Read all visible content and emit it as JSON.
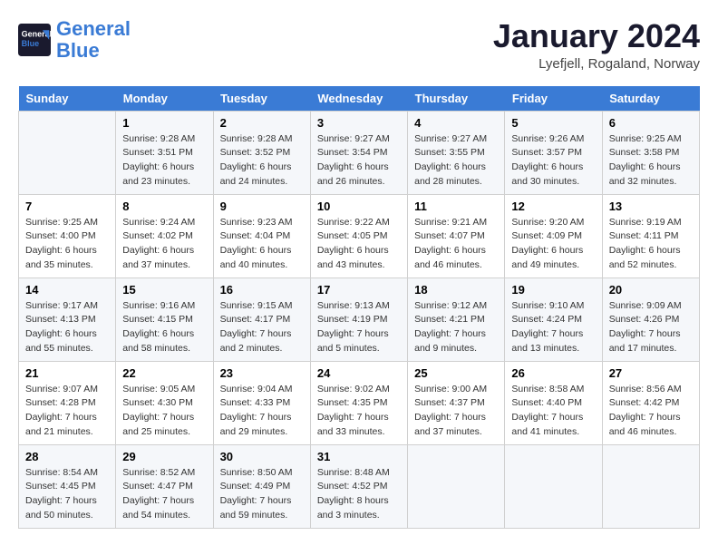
{
  "header": {
    "logo_line1": "General",
    "logo_line2": "Blue",
    "month_title": "January 2024",
    "location": "Lyefjell, Rogaland, Norway"
  },
  "weekdays": [
    "Sunday",
    "Monday",
    "Tuesday",
    "Wednesday",
    "Thursday",
    "Friday",
    "Saturday"
  ],
  "weeks": [
    [
      {
        "day": "",
        "info": ""
      },
      {
        "day": "1",
        "info": "Sunrise: 9:28 AM\nSunset: 3:51 PM\nDaylight: 6 hours\nand 23 minutes."
      },
      {
        "day": "2",
        "info": "Sunrise: 9:28 AM\nSunset: 3:52 PM\nDaylight: 6 hours\nand 24 minutes."
      },
      {
        "day": "3",
        "info": "Sunrise: 9:27 AM\nSunset: 3:54 PM\nDaylight: 6 hours\nand 26 minutes."
      },
      {
        "day": "4",
        "info": "Sunrise: 9:27 AM\nSunset: 3:55 PM\nDaylight: 6 hours\nand 28 minutes."
      },
      {
        "day": "5",
        "info": "Sunrise: 9:26 AM\nSunset: 3:57 PM\nDaylight: 6 hours\nand 30 minutes."
      },
      {
        "day": "6",
        "info": "Sunrise: 9:25 AM\nSunset: 3:58 PM\nDaylight: 6 hours\nand 32 minutes."
      }
    ],
    [
      {
        "day": "7",
        "info": "Sunrise: 9:25 AM\nSunset: 4:00 PM\nDaylight: 6 hours\nand 35 minutes."
      },
      {
        "day": "8",
        "info": "Sunrise: 9:24 AM\nSunset: 4:02 PM\nDaylight: 6 hours\nand 37 minutes."
      },
      {
        "day": "9",
        "info": "Sunrise: 9:23 AM\nSunset: 4:04 PM\nDaylight: 6 hours\nand 40 minutes."
      },
      {
        "day": "10",
        "info": "Sunrise: 9:22 AM\nSunset: 4:05 PM\nDaylight: 6 hours\nand 43 minutes."
      },
      {
        "day": "11",
        "info": "Sunrise: 9:21 AM\nSunset: 4:07 PM\nDaylight: 6 hours\nand 46 minutes."
      },
      {
        "day": "12",
        "info": "Sunrise: 9:20 AM\nSunset: 4:09 PM\nDaylight: 6 hours\nand 49 minutes."
      },
      {
        "day": "13",
        "info": "Sunrise: 9:19 AM\nSunset: 4:11 PM\nDaylight: 6 hours\nand 52 minutes."
      }
    ],
    [
      {
        "day": "14",
        "info": "Sunrise: 9:17 AM\nSunset: 4:13 PM\nDaylight: 6 hours\nand 55 minutes."
      },
      {
        "day": "15",
        "info": "Sunrise: 9:16 AM\nSunset: 4:15 PM\nDaylight: 6 hours\nand 58 minutes."
      },
      {
        "day": "16",
        "info": "Sunrise: 9:15 AM\nSunset: 4:17 PM\nDaylight: 7 hours\nand 2 minutes."
      },
      {
        "day": "17",
        "info": "Sunrise: 9:13 AM\nSunset: 4:19 PM\nDaylight: 7 hours\nand 5 minutes."
      },
      {
        "day": "18",
        "info": "Sunrise: 9:12 AM\nSunset: 4:21 PM\nDaylight: 7 hours\nand 9 minutes."
      },
      {
        "day": "19",
        "info": "Sunrise: 9:10 AM\nSunset: 4:24 PM\nDaylight: 7 hours\nand 13 minutes."
      },
      {
        "day": "20",
        "info": "Sunrise: 9:09 AM\nSunset: 4:26 PM\nDaylight: 7 hours\nand 17 minutes."
      }
    ],
    [
      {
        "day": "21",
        "info": "Sunrise: 9:07 AM\nSunset: 4:28 PM\nDaylight: 7 hours\nand 21 minutes."
      },
      {
        "day": "22",
        "info": "Sunrise: 9:05 AM\nSunset: 4:30 PM\nDaylight: 7 hours\nand 25 minutes."
      },
      {
        "day": "23",
        "info": "Sunrise: 9:04 AM\nSunset: 4:33 PM\nDaylight: 7 hours\nand 29 minutes."
      },
      {
        "day": "24",
        "info": "Sunrise: 9:02 AM\nSunset: 4:35 PM\nDaylight: 7 hours\nand 33 minutes."
      },
      {
        "day": "25",
        "info": "Sunrise: 9:00 AM\nSunset: 4:37 PM\nDaylight: 7 hours\nand 37 minutes."
      },
      {
        "day": "26",
        "info": "Sunrise: 8:58 AM\nSunset: 4:40 PM\nDaylight: 7 hours\nand 41 minutes."
      },
      {
        "day": "27",
        "info": "Sunrise: 8:56 AM\nSunset: 4:42 PM\nDaylight: 7 hours\nand 46 minutes."
      }
    ],
    [
      {
        "day": "28",
        "info": "Sunrise: 8:54 AM\nSunset: 4:45 PM\nDaylight: 7 hours\nand 50 minutes."
      },
      {
        "day": "29",
        "info": "Sunrise: 8:52 AM\nSunset: 4:47 PM\nDaylight: 7 hours\nand 54 minutes."
      },
      {
        "day": "30",
        "info": "Sunrise: 8:50 AM\nSunset: 4:49 PM\nDaylight: 7 hours\nand 59 minutes."
      },
      {
        "day": "31",
        "info": "Sunrise: 8:48 AM\nSunset: 4:52 PM\nDaylight: 8 hours\nand 3 minutes."
      },
      {
        "day": "",
        "info": ""
      },
      {
        "day": "",
        "info": ""
      },
      {
        "day": "",
        "info": ""
      }
    ]
  ]
}
